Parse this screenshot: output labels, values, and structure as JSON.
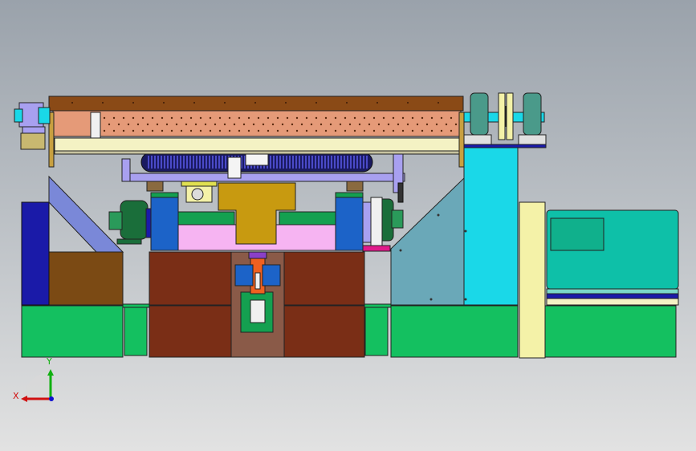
{
  "viewport": {
    "background_top": "#9aa2ab",
    "background_bottom": "#e2e2e2"
  },
  "triad": {
    "x_label": "X",
    "y_label": "Y",
    "x_color": "#d01010",
    "y_color": "#10b010",
    "z_color": "#1010d0"
  },
  "colors": {
    "green": "#14c060",
    "brown": "#7a2e16",
    "dark_brown": "#7b4a14",
    "salmon": "#e59a78",
    "conveyor_top": "#8a4a16",
    "cream": "#f4f2c4",
    "cyan": "#1ad8e8",
    "teal": "#0ec0a8",
    "blue": "#1c63c8",
    "navy": "#1a1aa8",
    "pink": "#f6b4f2",
    "mustard": "#c89a10",
    "slate": "#6aa8b8",
    "lavender": "#a8a0f0",
    "pale_yellow": "#f4f2a8",
    "orange": "#f06020",
    "dark_green_motor": "#1a6e3a",
    "magenta": "#e01a8a"
  }
}
